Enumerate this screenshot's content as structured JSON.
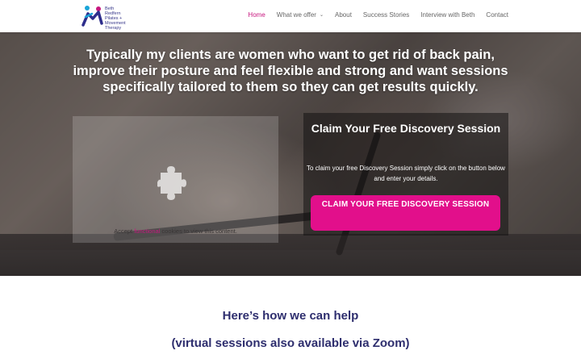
{
  "brand": {
    "logo_lines": [
      "Beth",
      "Redfern",
      "Pilates +",
      "Movement",
      "Therapy"
    ],
    "colors": {
      "accent": "#c7177f",
      "cta": "#e20f8b",
      "heading_blue": "#2e2e6e"
    }
  },
  "nav": {
    "items": [
      {
        "label": "Home",
        "active": true
      },
      {
        "label": "What we offer",
        "has_dropdown": true
      },
      {
        "label": "About"
      },
      {
        "label": "Success Stories"
      },
      {
        "label": "Interview with Beth"
      },
      {
        "label": "Contact"
      }
    ]
  },
  "hero": {
    "heading": "Typically my clients are women who want to get rid of back pain, improve their posture and feel flexible and strong and want sessions specifically tailored to them so they can get results quickly.",
    "cookie_notice": {
      "prefix": "Accept ",
      "link": "functional",
      "suffix": " cookies to view this content.",
      "icon": "puzzle-piece-icon"
    },
    "cta": {
      "title": "Claim Your Free Discovery Session",
      "description": "To claim your free Discovery Session simply click on the button below and enter your details.",
      "button_label": "CLAIM YOUR FREE DISCOVERY SESSION"
    }
  },
  "help": {
    "title": "Here’s how we can help",
    "subtitle": "(virtual sessions also available via Zoom)"
  }
}
